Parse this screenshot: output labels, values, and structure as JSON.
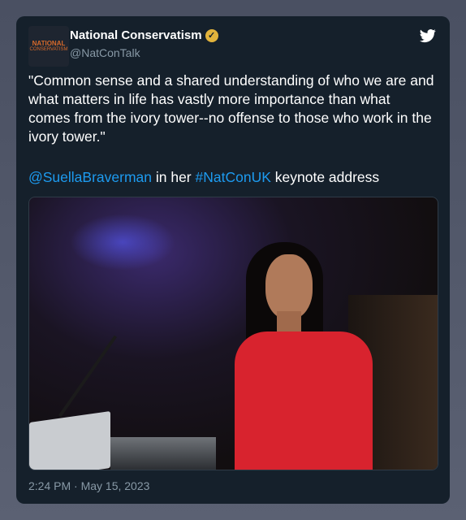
{
  "author": {
    "display_name": "National Conservatism",
    "handle": "@NatConTalk",
    "avatar_line1": "NATIONAL",
    "avatar_line2": "CONSERVATISM"
  },
  "tweet": {
    "text": "\"Common sense and a shared understanding of who we are and what matters in life has vastly more importance than what comes from the ivory tower--no offense to those who work in the ivory tower.\"",
    "mention": "@SuellaBraverman",
    "connector": " in her ",
    "hashtag": "#NatConUK",
    "suffix": " keynote address",
    "timestamp": "2:24 PM · May 15, 2023"
  },
  "colors": {
    "card_background": "#15202b",
    "link": "#1d9bf0",
    "verified_badge": "#e2b33c",
    "muted_text": "#8899a6"
  },
  "icons": [
    "twitter-bird-icon",
    "verified-badge-icon"
  ]
}
